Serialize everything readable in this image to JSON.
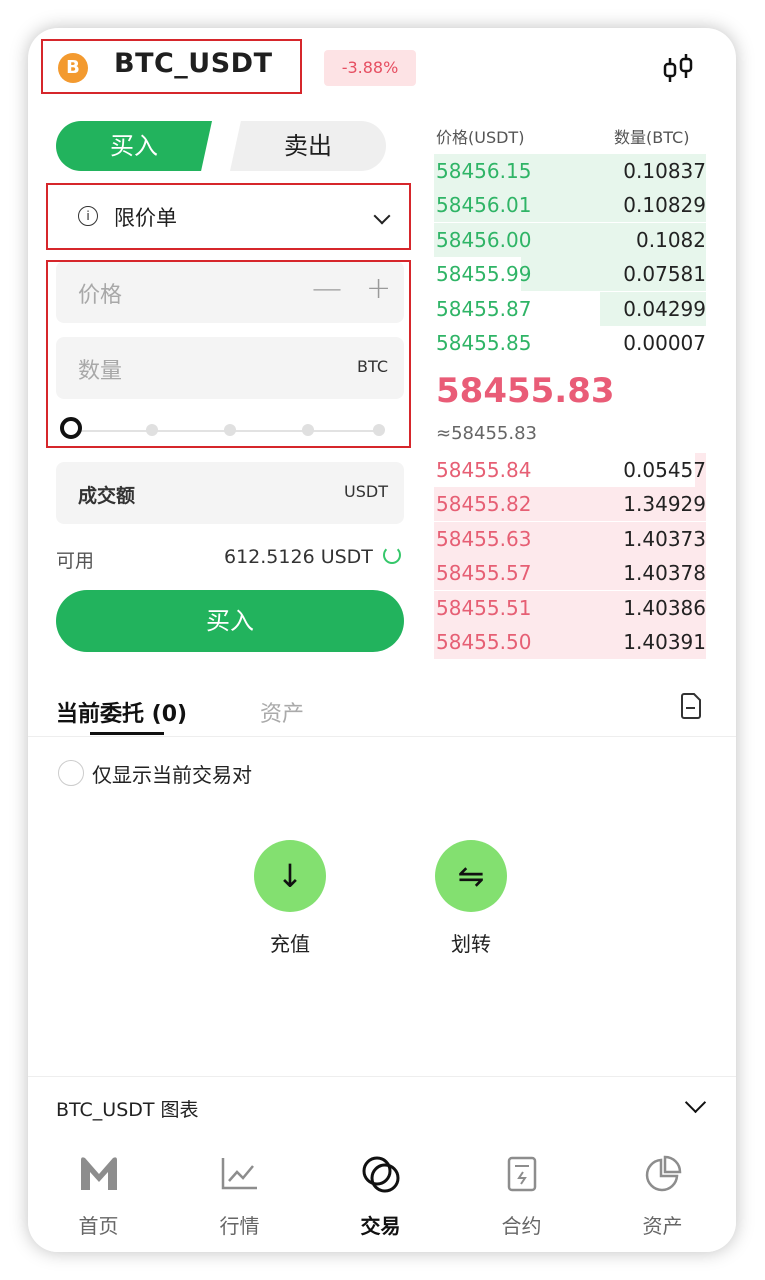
{
  "header": {
    "coin_icon": "B",
    "pair": "BTC_USDT",
    "change": "-3.88%",
    "kline_icon": "candlestick-icon"
  },
  "trade": {
    "tab_buy": "买入",
    "tab_sell": "卖出",
    "order_type": "限价单",
    "price_placeholder": "价格",
    "price_minus": "—",
    "price_plus": "+",
    "amount_placeholder": "数量",
    "amount_unit": "BTC",
    "turnover_label": "成交额",
    "turnover_unit": "USDT",
    "slider_percent": 0,
    "available_label": "可用",
    "available_value": "612.5126 USDT",
    "buy_button": "买入"
  },
  "orderbook": {
    "price_header": "价格(USDT)",
    "qty_header": "数量(BTC)",
    "asks": [
      {
        "price": "58456.15",
        "qty": "0.10837",
        "depth": 1.0
      },
      {
        "price": "58456.01",
        "qty": "0.10829",
        "depth": 1.0
      },
      {
        "price": "58456.00",
        "qty": "0.1082",
        "depth": 1.0
      },
      {
        "price": "58455.99",
        "qty": "0.07581",
        "depth": 0.68
      },
      {
        "price": "58455.87",
        "qty": "0.04299",
        "depth": 0.39
      },
      {
        "price": "58455.85",
        "qty": "0.00007",
        "depth": 0.0
      }
    ],
    "last_price": "58455.83",
    "last_price_ref": "≈58455.83",
    "bids": [
      {
        "price": "58455.84",
        "qty": "0.05457",
        "depth": 0.04
      },
      {
        "price": "58455.82",
        "qty": "1.34929",
        "depth": 1.0
      },
      {
        "price": "58455.63",
        "qty": "1.40373",
        "depth": 1.0
      },
      {
        "price": "58455.57",
        "qty": "1.40378",
        "depth": 1.0
      },
      {
        "price": "58455.51",
        "qty": "1.40386",
        "depth": 1.0
      },
      {
        "price": "58455.50",
        "qty": "1.40391",
        "depth": 1.0
      }
    ]
  },
  "orders": {
    "tab_current": "当前委托 (0)",
    "tab_assets": "资产",
    "only_current_pair": "仅显示当前交易对",
    "deposit_label": "充值",
    "deposit_icon": "↓",
    "transfer_label": "划转",
    "transfer_icon": "⇋"
  },
  "chart_bar": {
    "title": "BTC_USDT 图表"
  },
  "nav": [
    {
      "label": "首页",
      "icon": "mexc-logo-icon",
      "active": false
    },
    {
      "label": "行情",
      "icon": "market-chart-icon",
      "active": false
    },
    {
      "label": "交易",
      "icon": "trade-circles-icon",
      "active": true
    },
    {
      "label": "合约",
      "icon": "contract-doc-icon",
      "active": false
    },
    {
      "label": "资产",
      "icon": "pie-chart-icon",
      "active": false
    }
  ],
  "colors": {
    "green": "#22b35d",
    "red": "#e95c77",
    "highlight_box": "#d6262b"
  }
}
